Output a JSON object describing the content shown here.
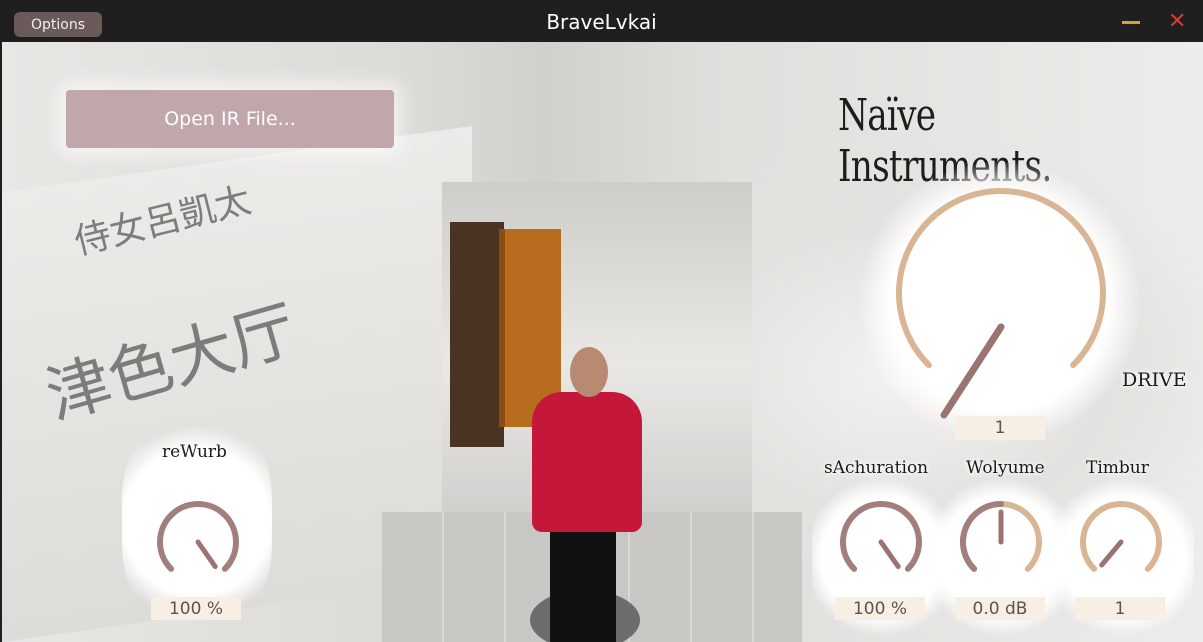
{
  "window": {
    "options_label": "Options",
    "title": "BraveLvkai",
    "minimize_glyph": "—",
    "close_glyph": "✕"
  },
  "main": {
    "open_ir_label": "Open IR File...",
    "brand": "Naïve Instruments.",
    "background_text": [
      "侍女呂凱太",
      "津色大厅"
    ]
  },
  "knobs": {
    "drive": {
      "label": "DRIVE",
      "value": "1"
    },
    "reverb": {
      "label": "reWurb",
      "value": "100 %"
    },
    "saturation": {
      "label": "sAchuration",
      "value": "100 %"
    },
    "volume": {
      "label": "Wolyume",
      "value": "0.0 dB"
    },
    "timbre": {
      "label": "Timbur",
      "value": "1"
    }
  },
  "colors": {
    "drive_arc": "#d9b594",
    "knob_dark": "#a07f7c",
    "timbre_arc": "#d9b594",
    "pointer": "#9a7372",
    "value_bg": "#f8efe4"
  }
}
